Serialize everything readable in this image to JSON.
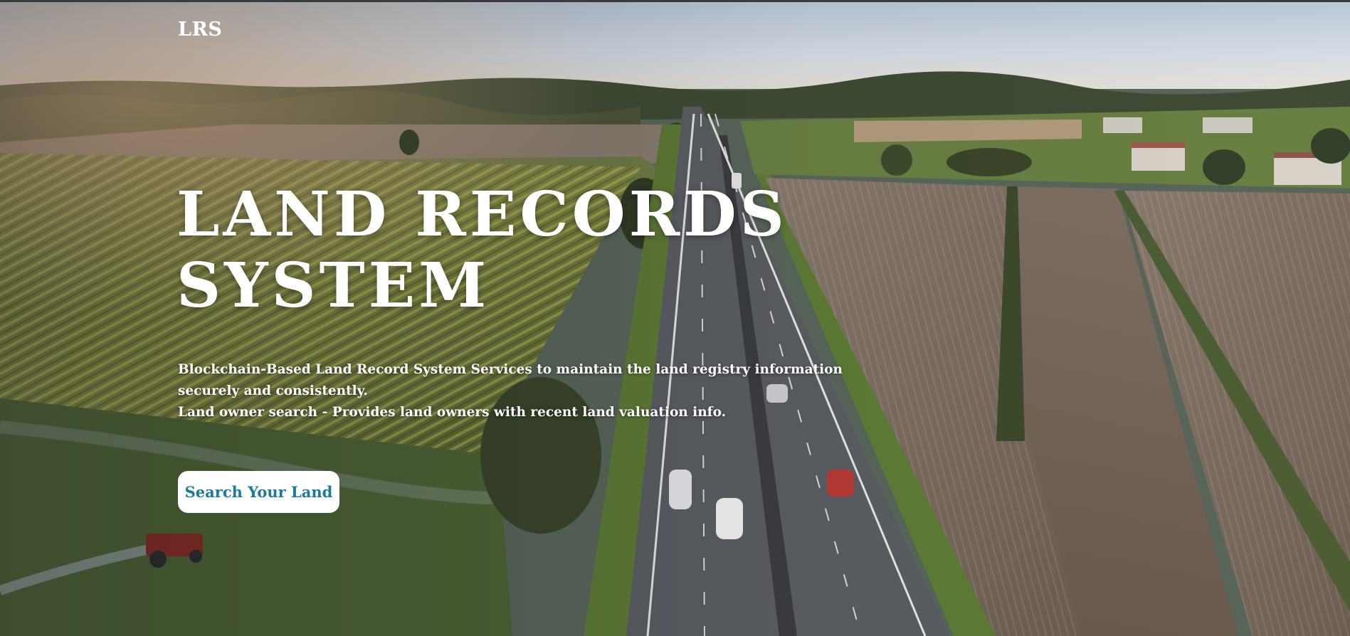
{
  "header": {
    "brand": "LRS"
  },
  "hero": {
    "title_line1": "LAND RECORDS",
    "title_line2": "SYSTEM",
    "description_line1": "Blockchain-Based Land Record System Services to maintain the land registry information securely and consistently.",
    "description_line2": "Land owner search - Provides land owners with recent land valuation info.",
    "cta_label": "Search Your Land"
  },
  "colors": {
    "cta_text": "#1b7a9e",
    "cta_background": "#ffffff",
    "hero_text": "#ffffff"
  }
}
